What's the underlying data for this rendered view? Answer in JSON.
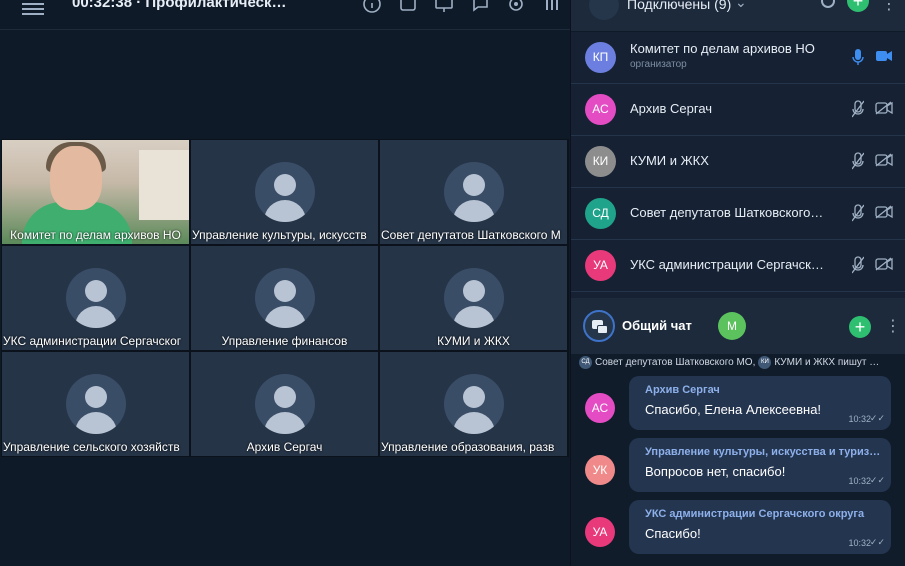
{
  "topbar": {
    "timer": "00:32:38",
    "meeting_title": "Профилактическ…"
  },
  "grid": {
    "tiles": [
      {
        "name": "Комитет по делам архивов НО",
        "camera": true
      },
      {
        "name": "Управление культуры, искусств"
      },
      {
        "name": "Совет депутатов Шатковского М"
      },
      {
        "name": "УКС администрации Сергачског"
      },
      {
        "name": "Управление финансов"
      },
      {
        "name": "КУМИ и ЖКХ"
      },
      {
        "name": "Управление сельского хозяйств"
      },
      {
        "name": "Архив Сергач"
      },
      {
        "name": "Управление образования, разв"
      }
    ]
  },
  "panel": {
    "title": "Подключены",
    "count": "(9)",
    "participants": [
      {
        "initials": "КП",
        "name": "Комитет по делам архивов НО",
        "role": "организатор",
        "color": "#6c7fe0",
        "mic_on": true,
        "cam_on": true
      },
      {
        "initials": "АС",
        "name": "Архив Сергач",
        "color": "#e44cc4",
        "mic_on": false,
        "cam_on": false
      },
      {
        "initials": "КИ",
        "name": "КУМИ и ЖКХ",
        "color": "#8d8d8d",
        "mic_on": false,
        "cam_on": false
      },
      {
        "initials": "СД",
        "name": "Совет депутатов Шатковского…",
        "color": "#1fa38a",
        "mic_on": false,
        "cam_on": false
      },
      {
        "initials": "УА",
        "name": "УКС администрации Сергачск…",
        "color": "#e8397a",
        "mic_on": false,
        "cam_on": false
      }
    ]
  },
  "chat": {
    "title": "Общий чат",
    "badge": "М",
    "typing": {
      "a_initials": "СД",
      "a_text": "Совет депутатов Шатковского МО,",
      "b_initials": "КИ",
      "b_text": "КУМИ и ЖКХ пишут …"
    },
    "messages": [
      {
        "initials": "АС",
        "color": "#e44cc4",
        "sender": "Архив Сергач",
        "text": "Спасибо, Елена Алексеевна!",
        "time": "10:32"
      },
      {
        "initials": "УК",
        "color": "#f08a8a",
        "sender": "Управление культуры, искусства и туриз…",
        "text": "Вопросов нет, спасибо!",
        "time": "10:32"
      },
      {
        "initials": "УА",
        "color": "#e8397a",
        "sender": "УКС администрации Сергачского округа",
        "text": "Спасибо!",
        "time": "10:32"
      }
    ]
  }
}
